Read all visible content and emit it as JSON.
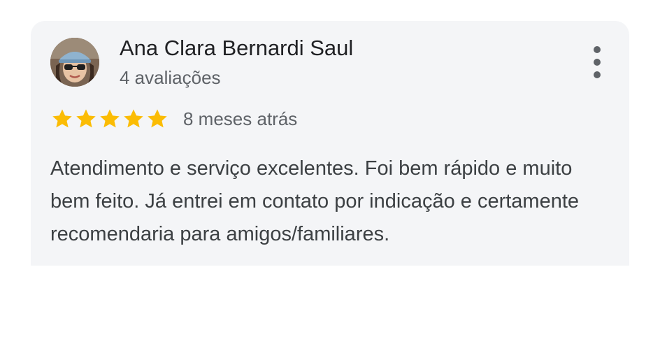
{
  "review": {
    "reviewer_name": "Ana Clara Bernardi Saul",
    "reviewer_reviews": "4 avaliações",
    "rating": 5,
    "rating_max": 5,
    "time_ago": "8 meses atrás",
    "text": "Atendimento e serviço excelentes. Foi bem rápido e muito bem feito. Já entrei em contato por indicação e certamente recomendaria para amigos/familiares."
  },
  "icons": {
    "more": "more-vert-icon",
    "star": "star-icon",
    "avatar": "avatar"
  },
  "colors": {
    "card_bg": "#f4f5f7",
    "star": "#fbbc04",
    "name": "#202124",
    "secondary": "#5f6368",
    "body_text": "#3c4043"
  }
}
